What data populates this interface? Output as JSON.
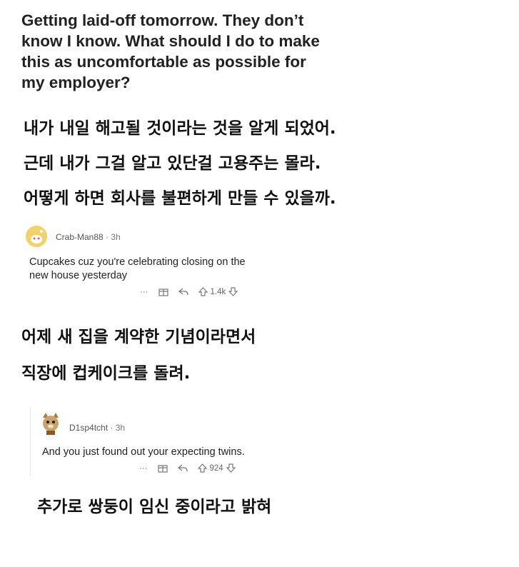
{
  "post": {
    "title_lines": [
      "Getting laid-off tomorrow. They don’t",
      "know I know. What should I do to make",
      "this as uncomfortable as possible for",
      "my employer?"
    ]
  },
  "translation_1": [
    "내가 내일 해고될 것이라는 것을 알게 되었어.",
    "근데 내가 그걸 알고 있단걸 고용주는 몰라.",
    "어떻게 하면 회사를 불편하게 만들 수 있을까."
  ],
  "comment_1": {
    "username": "Crab-Man88",
    "separator": "·",
    "age": "3h",
    "text_lines": [
      "Cupcakes cuz you're celebrating closing on the",
      "new house yesterday"
    ],
    "more": "···",
    "vote_count": "1.4k",
    "icons": [
      "avatar-snoo-icon",
      "more-icon",
      "gift-icon",
      "reply-icon",
      "upvote-icon",
      "downvote-icon"
    ]
  },
  "translation_2": [
    "어제 새 집을 계약한 기념이라면서",
    "직장에 컵케이크를 돌려."
  ],
  "comment_2": {
    "username": "D1sp4tcht",
    "separator": "·",
    "age": "3h",
    "text_lines": [
      "And you just found out your expecting twins."
    ],
    "more": "···",
    "vote_count": "924",
    "icons": [
      "avatar-cat-icon",
      "more-icon",
      "gift-icon",
      "reply-icon",
      "upvote-icon",
      "downvote-icon"
    ]
  },
  "translation_3": [
    "추가로 쌍둥이 임신 중이라고 밝혀"
  ],
  "colors": {
    "title": "#222222",
    "meta": "#777777",
    "avatar_1": "#f2d36b",
    "avatar_2": "#c9a36a"
  }
}
